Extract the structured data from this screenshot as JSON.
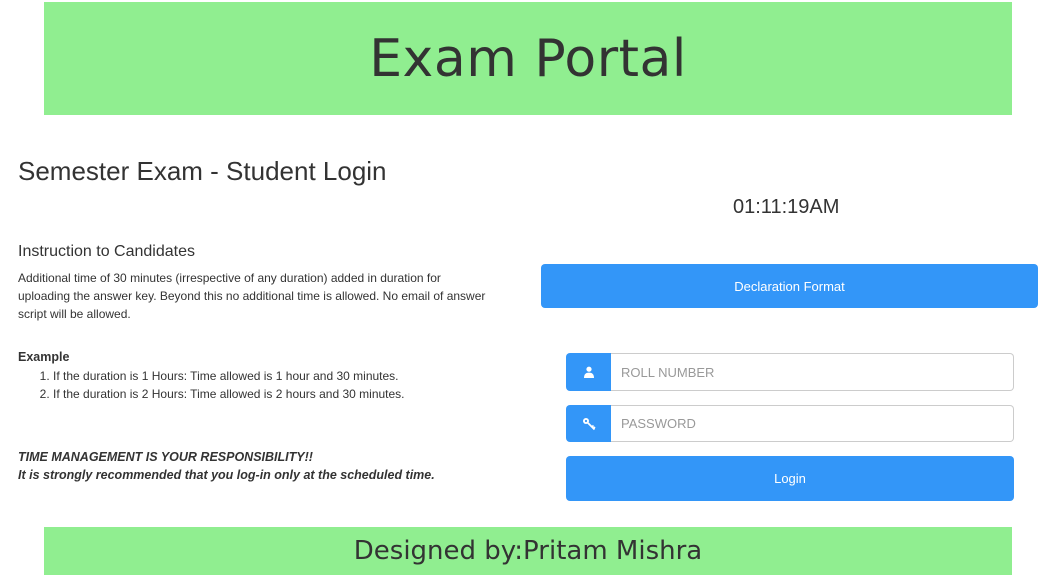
{
  "header": {
    "title": "Exam Portal"
  },
  "page_heading": "Semester Exam - Student Login",
  "clock": "01:11:19AM",
  "instructions": {
    "heading": "Instruction to Candidates",
    "text": "Additional time of 30 minutes (irrespective of any duration) added in duration for uploading the answer key. Beyond this no additional time is allowed. No email of answer script will be allowed.",
    "example_label": "Example",
    "examples": [
      "If the duration is 1 Hours: Time allowed is 1 hour and 30 minutes.",
      "If the duration is 2 Hours: Time allowed is 2 hours and 30 minutes."
    ],
    "warning_line1": "TIME MANAGEMENT IS YOUR RESPONSIBILITY!!",
    "warning_line2": "It is strongly recommended that you log-in only at the scheduled time."
  },
  "declaration_button": "Declaration Format",
  "login_form": {
    "roll_placeholder": "ROLL NUMBER",
    "roll_value": "",
    "roll_icon": "user-icon",
    "password_placeholder": "PASSWORD",
    "password_value": "",
    "password_icon": "key-icon",
    "login_label": "Login"
  },
  "footer": {
    "text": "Designed by:Pritam Mishra"
  },
  "colors": {
    "banner": "#90ee90",
    "accent": "#3396f8",
    "text": "#333333"
  }
}
